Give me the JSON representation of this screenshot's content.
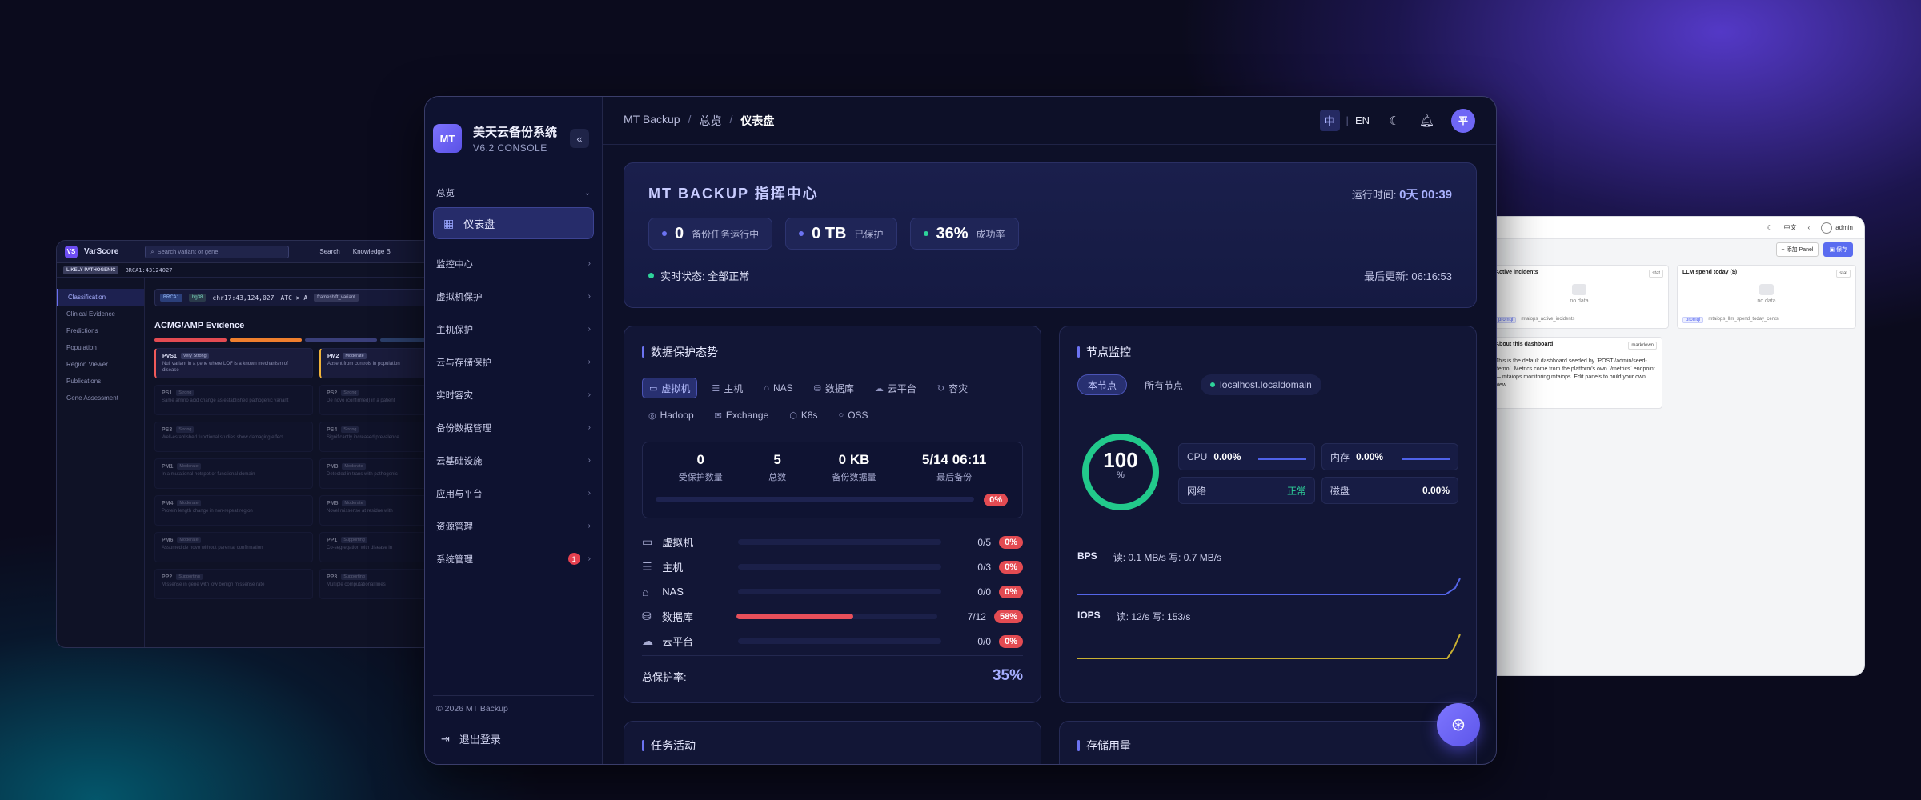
{
  "left_window": {
    "logo": "VS",
    "brand": "VarScore",
    "search_placeholder": "Search variant or gene",
    "nav": [
      "Search",
      "Knowledge B"
    ],
    "badge": "LIKELY PATHOGENIC",
    "variant_id": "BRCA1:43124027",
    "side_items": [
      "Classification",
      "Clinical Evidence",
      "Predictions",
      "Population",
      "Region Viewer",
      "Publications",
      "Gene Assessment"
    ],
    "variant_line": {
      "gene": "BRCA1",
      "build": "hg38",
      "pos": "chr17:43,124,027",
      "change": "ATC > A",
      "type": "frameshift_variant"
    },
    "section_title": "ACMG/AMP Evidence",
    "cards": [
      {
        "code": "PVS1",
        "tag": "Very Strong",
        "desc": "Null variant in a gene where LOF is a known mechanism of disease"
      },
      {
        "code": "PM2",
        "tag": "Moderate",
        "desc": "Absent from controls in population"
      },
      {
        "code": "PS1",
        "tag": "Strong",
        "desc": "Same amino acid change as established pathogenic variant"
      },
      {
        "code": "PS2",
        "tag": "Strong",
        "desc": "De novo (confirmed) in a patient"
      },
      {
        "code": "PS3",
        "tag": "Strong",
        "desc": "Well-established functional studies show damaging effect"
      },
      {
        "code": "PS4",
        "tag": "Strong",
        "desc": "Significantly increased prevalence"
      },
      {
        "code": "PM1",
        "tag": "Moderate",
        "desc": "In a mutational hotspot or functional domain"
      },
      {
        "code": "PM3",
        "tag": "Moderate",
        "desc": "Detected in trans with pathogenic"
      },
      {
        "code": "PM4",
        "tag": "Moderate",
        "desc": "Protein length change in non-repeat region"
      },
      {
        "code": "PM5",
        "tag": "Moderate",
        "desc": "Novel missense at residue with"
      },
      {
        "code": "PM6",
        "tag": "Moderate",
        "desc": "Assumed de novo without parental confirmation"
      },
      {
        "code": "PP1",
        "tag": "Supporting",
        "desc": "Co-segregation with disease in"
      },
      {
        "code": "PP2",
        "tag": "Supporting",
        "desc": "Missense in gene with low benign missense rate"
      },
      {
        "code": "PP3",
        "tag": "Supporting",
        "desc": "Multiple computational lines"
      }
    ]
  },
  "right_window": {
    "lang": "中文",
    "user": "admin",
    "add_panel": "+ 添加 Panel",
    "save": "保存",
    "panels": [
      {
        "title": "Active incidents",
        "tag": "stat",
        "empty": "no data",
        "query_lang": "promql",
        "query": "mtaiops_active_incidents"
      },
      {
        "title": "LLM spend today ($)",
        "tag": "stat",
        "empty": "no data",
        "query_lang": "promql",
        "query": "mtaiops_llm_spend_today_cents"
      }
    ],
    "about": {
      "title": "About this dashboard",
      "tag": "markdown",
      "text": "This is the default dashboard seeded by `POST /admin/seed-demo`. Metrics come from the platform's own `/metrics` endpoint — mtaiops monitoring mtaiops. Edit panels to build your own view."
    }
  },
  "sidebar": {
    "logo": "MT",
    "app_name": "美天云备份系统",
    "version": "V6.2 CONSOLE",
    "collapse_glyph": "«",
    "overview_label": "总览",
    "active_item": "仪表盘",
    "items": [
      {
        "label": "监控中心"
      },
      {
        "label": "虚拟机保护"
      },
      {
        "label": "主机保护"
      },
      {
        "label": "云与存储保护"
      },
      {
        "label": "实时容灾"
      },
      {
        "label": "备份数据管理"
      },
      {
        "label": "云基础设施"
      },
      {
        "label": "应用与平台"
      },
      {
        "label": "资源管理"
      },
      {
        "label": "系统管理",
        "badge": "1"
      }
    ],
    "copyright": "© 2026 MT Backup",
    "logout": "退出登录"
  },
  "topbar": {
    "breadcrumb": [
      "MT Backup",
      "总览",
      "仪表盘"
    ],
    "lang_zh": "中",
    "lang_en": "EN",
    "avatar": "平"
  },
  "hero": {
    "title": "MT BACKUP 指挥中心",
    "uptime_label": "运行时间:",
    "uptime": "0天 00:39",
    "stats": [
      {
        "value": "0",
        "label": "备份任务运行中",
        "color": "#6c73f2"
      },
      {
        "value": "0 TB",
        "label": "已保护",
        "color": "#6c73f2"
      },
      {
        "value": "36%",
        "label": "成功率",
        "color": "#2ed39a"
      }
    ],
    "status": "实时状态: 全部正常",
    "last_update": "最后更新: 06:16:53"
  },
  "protection": {
    "title": "数据保护态势",
    "tabs": [
      {
        "icon": "▭",
        "label": "虚拟机"
      },
      {
        "icon": "☰",
        "label": "主机"
      },
      {
        "icon": "⌂",
        "label": "NAS"
      },
      {
        "icon": "⛁",
        "label": "数据库"
      },
      {
        "icon": "☁",
        "label": "云平台"
      },
      {
        "icon": "↻",
        "label": "容灾"
      },
      {
        "icon": "◎",
        "label": "Hadoop"
      },
      {
        "icon": "✉",
        "label": "Exchange"
      },
      {
        "icon": "⬡",
        "label": "K8s"
      },
      {
        "icon": "○",
        "label": "OSS"
      }
    ],
    "summary": [
      {
        "value": "0",
        "label": "受保护数量"
      },
      {
        "value": "5",
        "label": "总数"
      },
      {
        "value": "0 KB",
        "label": "备份数据量"
      },
      {
        "value": "5/14 06:11",
        "label": "最后备份"
      }
    ],
    "summary_pct": "0%",
    "rows": [
      {
        "icon": "▭",
        "label": "虚拟机",
        "count": "0/5",
        "pct": "0%",
        "fill": 0
      },
      {
        "icon": "☰",
        "label": "主机",
        "count": "0/3",
        "pct": "0%",
        "fill": 0
      },
      {
        "icon": "⌂",
        "label": "NAS",
        "count": "0/0",
        "pct": "0%",
        "fill": 0
      },
      {
        "icon": "⛁",
        "label": "数据库",
        "count": "7/12",
        "pct": "58%",
        "fill": 0.58
      },
      {
        "icon": "☁",
        "label": "云平台",
        "count": "0/0",
        "pct": "0%",
        "fill": 0
      }
    ],
    "total_label": "总保护率:",
    "total_value": "35%"
  },
  "node": {
    "title": "节点监控",
    "tabs": [
      "本节点",
      "所有节点",
      "localhost.localdomain"
    ],
    "gauge_value": "100",
    "gauge_unit": "%",
    "gauge_fill": 1.0,
    "metrics": [
      {
        "label": "CPU",
        "value": "0.00%"
      },
      {
        "label": "内存",
        "value": "0.00%"
      },
      {
        "label": "网络",
        "value": "正常"
      },
      {
        "label": "磁盘",
        "value": "0.00%"
      }
    ],
    "bps_label": "BPS",
    "bps_value": "读: 0.1 MB/s 写: 0.7 MB/s",
    "iops_label": "IOPS",
    "iops_value": "读: 12/s 写: 153/s"
  },
  "task": {
    "title": "任务活动"
  },
  "storage": {
    "title": "存储用量"
  },
  "colors": {
    "accent": "#6c73f2",
    "ok": "#2ed39a",
    "danger": "#e84f5a",
    "iops": "#c9b032"
  }
}
